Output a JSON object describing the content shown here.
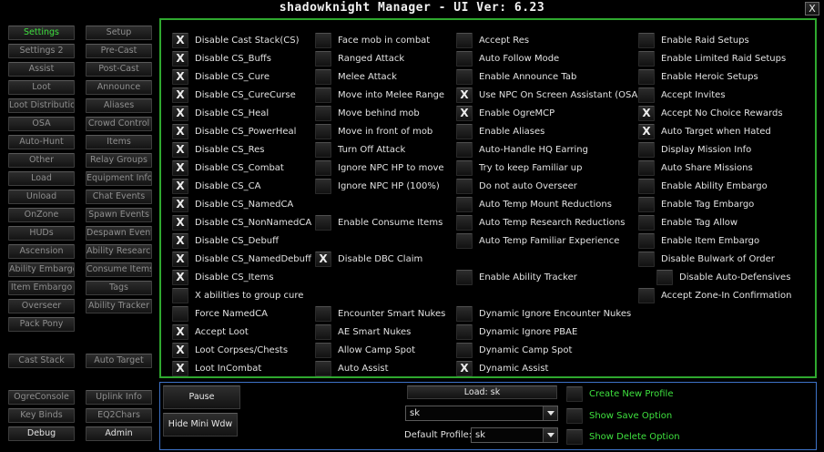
{
  "window": {
    "title": "shadowknight Manager  - UI Ver: 6.23",
    "close": "X"
  },
  "nav": [
    {
      "label": "Settings",
      "state": "active"
    },
    {
      "label": "Setup",
      "state": ""
    },
    {
      "label": "Settings 2",
      "state": ""
    },
    {
      "label": "Pre-Cast",
      "state": ""
    },
    {
      "label": "Assist",
      "state": ""
    },
    {
      "label": "Post-Cast",
      "state": ""
    },
    {
      "label": "Loot",
      "state": ""
    },
    {
      "label": "Announce",
      "state": ""
    },
    {
      "label": "Loot Distribution",
      "state": ""
    },
    {
      "label": "Aliases",
      "state": ""
    },
    {
      "label": "OSA",
      "state": ""
    },
    {
      "label": "Crowd Control",
      "state": ""
    },
    {
      "label": "Auto-Hunt",
      "state": ""
    },
    {
      "label": "Items",
      "state": ""
    },
    {
      "label": "Other",
      "state": ""
    },
    {
      "label": "Relay Groups",
      "state": ""
    },
    {
      "label": "Load",
      "state": ""
    },
    {
      "label": "Equipment Info",
      "state": ""
    },
    {
      "label": "Unload",
      "state": ""
    },
    {
      "label": "Chat Events",
      "state": ""
    },
    {
      "label": "OnZone",
      "state": ""
    },
    {
      "label": "Spawn Events",
      "state": ""
    },
    {
      "label": "HUDs",
      "state": ""
    },
    {
      "label": "Despawn Events",
      "state": ""
    },
    {
      "label": "Ascension",
      "state": ""
    },
    {
      "label": "Ability Research",
      "state": ""
    },
    {
      "label": "Ability Embargo",
      "state": ""
    },
    {
      "label": "Consume Items",
      "state": ""
    },
    {
      "label": "Item Embargo",
      "state": ""
    },
    {
      "label": "Tags",
      "state": ""
    },
    {
      "label": "Overseer",
      "state": ""
    },
    {
      "label": "Ability Tracker",
      "state": ""
    },
    {
      "label": "Pack Pony",
      "state": ""
    },
    {
      "label": "Cast Stack",
      "state": ""
    },
    {
      "label": "Auto Target",
      "state": ""
    },
    {
      "label": "OgreConsole",
      "state": ""
    },
    {
      "label": "Uplink Info",
      "state": ""
    },
    {
      "label": "Key Binds",
      "state": ""
    },
    {
      "label": "EQ2Chars",
      "state": ""
    },
    {
      "label": "Debug",
      "state": "bright"
    },
    {
      "label": "Admin",
      "state": "bright"
    }
  ],
  "settings": {
    "col1": [
      {
        "label": "Disable Cast Stack(CS)",
        "checked": true
      },
      {
        "label": "Disable CS_Buffs",
        "checked": true
      },
      {
        "label": "Disable CS_Cure",
        "checked": true
      },
      {
        "label": "Disable CS_CureCurse",
        "checked": true
      },
      {
        "label": "Disable CS_Heal",
        "checked": true
      },
      {
        "label": "Disable CS_PowerHeal",
        "checked": true
      },
      {
        "label": "Disable CS_Res",
        "checked": true
      },
      {
        "label": "Disable CS_Combat",
        "checked": true
      },
      {
        "label": "Disable CS_CA",
        "checked": true
      },
      {
        "label": "Disable CS_NamedCA",
        "checked": true
      },
      {
        "label": "Disable CS_NonNamedCA",
        "checked": true
      },
      {
        "label": "Disable CS_Debuff",
        "checked": true
      },
      {
        "label": "Disable CS_NamedDebuff",
        "checked": true
      },
      {
        "label": "Disable CS_Items",
        "checked": true
      },
      {
        "label": "X abilities to group cure",
        "checked": false
      },
      {
        "label": "Force NamedCA",
        "checked": false
      },
      {
        "label": "Accept Loot",
        "checked": true
      },
      {
        "label": "Loot Corpses/Chests",
        "checked": true
      },
      {
        "label": "Loot InCombat",
        "checked": true
      }
    ],
    "col2": [
      {
        "label": "Face mob in combat",
        "checked": false
      },
      {
        "label": "Ranged Attack",
        "checked": false
      },
      {
        "label": "Melee Attack",
        "checked": false
      },
      {
        "label": "Move into Melee Range",
        "checked": false
      },
      {
        "label": "Move behind mob",
        "checked": false
      },
      {
        "label": "Move in front of mob",
        "checked": false
      },
      {
        "label": "Turn Off Attack",
        "checked": false
      },
      {
        "label": "Ignore NPC HP to move",
        "checked": false
      },
      {
        "label": "Ignore NPC HP (100%)",
        "checked": false
      },
      null,
      {
        "label": "Enable Consume Items",
        "checked": false
      },
      null,
      {
        "label": "Disable DBC Claim",
        "checked": true
      },
      null,
      null,
      {
        "label": "Encounter Smart Nukes",
        "checked": false
      },
      {
        "label": "AE Smart Nukes",
        "checked": false
      },
      {
        "label": "Allow Camp Spot",
        "checked": false
      },
      {
        "label": "Auto Assist",
        "checked": false
      }
    ],
    "col3": [
      {
        "label": "Accept Res",
        "checked": false
      },
      {
        "label": "Auto Follow Mode",
        "checked": false
      },
      {
        "label": "Enable Announce Tab",
        "checked": false
      },
      {
        "label": "Use NPC On Screen Assistant (OSA)",
        "checked": true
      },
      {
        "label": "Enable OgreMCP",
        "checked": true
      },
      {
        "label": "Enable Aliases",
        "checked": false
      },
      {
        "label": "Auto-Handle HQ Earring",
        "checked": false
      },
      {
        "label": "Try to keep Familiar up",
        "checked": false
      },
      {
        "label": "Do not auto Overseer",
        "checked": false
      },
      {
        "label": "Auto Temp Mount Reductions",
        "checked": false
      },
      {
        "label": "Auto Temp Research Reductions",
        "checked": false
      },
      {
        "label": "Auto Temp Familiar Experience",
        "checked": false
      },
      null,
      {
        "label": "Enable Ability Tracker",
        "checked": false
      },
      null,
      {
        "label": "Dynamic Ignore Encounter Nukes",
        "checked": false
      },
      {
        "label": "Dynamic Ignore PBAE",
        "checked": false
      },
      {
        "label": "Dynamic Camp Spot",
        "checked": false
      },
      {
        "label": "Dynamic Assist",
        "checked": true
      }
    ],
    "col4": [
      {
        "label": "Enable Raid Setups",
        "checked": false
      },
      {
        "label": "Enable Limited Raid Setups",
        "checked": false
      },
      {
        "label": "Enable Heroic Setups",
        "checked": false
      },
      {
        "label": "Accept Invites",
        "checked": false
      },
      {
        "label": "Accept No Choice Rewards",
        "checked": true
      },
      {
        "label": "Auto Target when Hated",
        "checked": true
      },
      {
        "label": "Display Mission Info",
        "checked": false
      },
      {
        "label": "Auto Share Missions",
        "checked": false
      },
      {
        "label": "Enable Ability Embargo",
        "checked": false
      },
      {
        "label": "Enable Tag Embargo",
        "checked": false
      },
      {
        "label": "Enable Tag Allow",
        "checked": false
      },
      {
        "label": "Enable Item Embargo",
        "checked": false
      },
      {
        "label": "Disable Bulwark of Order",
        "checked": false
      },
      {
        "label": "Disable Auto-Defensives",
        "checked": false,
        "indent": true
      },
      {
        "label": "Accept Zone-In Confirmation",
        "checked": false
      }
    ]
  },
  "bottom": {
    "pause": "Pause",
    "hide_mini": "Hide Mini Wdw",
    "load_label": "Load: sk",
    "profile_value": "sk",
    "default_profile_label": "Default Profile:",
    "default_profile_value": "sk",
    "create_new": "Create New Profile",
    "show_save": "Show Save Option",
    "show_delete": "Show Delete Option"
  },
  "colors": {
    "accent_green": "#3ee03e",
    "panel_border": "#2fa82f",
    "bottom_border": "#3e73c8"
  }
}
